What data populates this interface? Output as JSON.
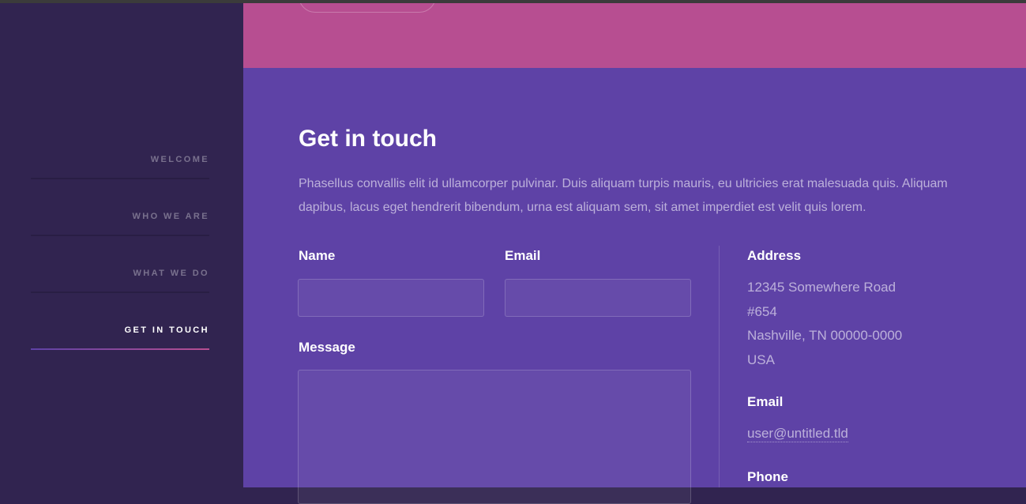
{
  "sidebar": {
    "items": [
      {
        "label": "Welcome",
        "active": false
      },
      {
        "label": "Who we are",
        "active": false
      },
      {
        "label": "What we do",
        "active": false
      },
      {
        "label": "Get in touch",
        "active": true
      }
    ]
  },
  "contact": {
    "title": "Get in touch",
    "intro": "Phasellus convallis elit id ullamcorper pulvinar. Duis aliquam turpis mauris, eu ultricies erat malesuada quis. Aliquam dapibus, lacus eget hendrerit bibendum, urna est aliquam sem, sit amet imperdiet est velit quis lorem.",
    "form": {
      "name_label": "Name",
      "name_value": "",
      "email_label": "Email",
      "email_value": "",
      "message_label": "Message",
      "message_value": ""
    },
    "info": {
      "address_heading": "Address",
      "address_lines": [
        "12345 Somewhere Road",
        "#654",
        "Nashville, TN 00000-0000",
        "USA"
      ],
      "email_heading": "Email",
      "email": "user@untitled.tld",
      "phone_heading": "Phone"
    }
  },
  "colors": {
    "sidebar_bg": "#312450",
    "main_bg": "#5e42a6",
    "accent_pink": "#b74e91"
  }
}
